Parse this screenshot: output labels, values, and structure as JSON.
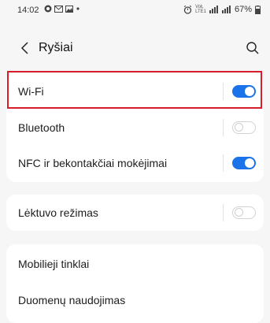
{
  "status_bar": {
    "time": "14:02",
    "left_icons": [
      "whatsapp-icon",
      "gmail-icon",
      "gallery-icon",
      "dot-icon"
    ],
    "network_line1": "VoŁ",
    "network_line2": "LTE1",
    "battery_percent": "67%"
  },
  "header": {
    "title": "Ryšiai"
  },
  "groups": [
    {
      "rows": [
        {
          "label": "Wi-Fi",
          "toggle": true
        },
        {
          "label": "Bluetooth",
          "toggle": false
        },
        {
          "label": "NFC ir bekontakčiai mokėjimai",
          "toggle": true
        }
      ]
    },
    {
      "rows": [
        {
          "label": "Lėktuvo režimas",
          "toggle": false
        }
      ]
    },
    {
      "rows": [
        {
          "label": "Mobilieji tinklai"
        },
        {
          "label": "Duomenų naudojimas"
        }
      ]
    }
  ],
  "colors": {
    "accent": "#1a73e8",
    "highlight": "#d81e2a",
    "background": "#f6f6f6"
  }
}
